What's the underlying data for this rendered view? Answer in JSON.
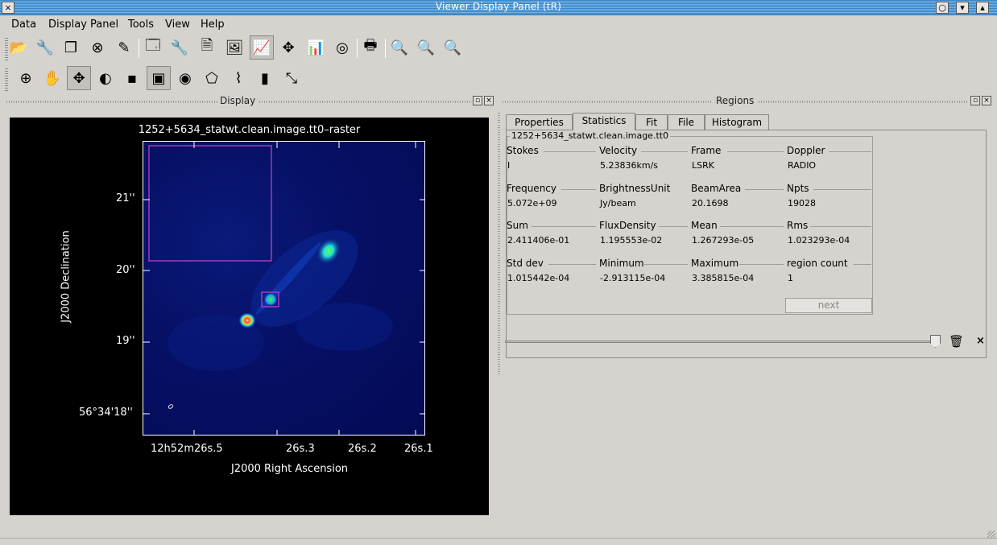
{
  "window": {
    "title": "Viewer Display Panel (tR)",
    "buttons": [
      "○",
      "▾",
      "▴"
    ],
    "close": "×"
  },
  "menu": [
    "Data",
    "Display Panel",
    "Tools",
    "View",
    "Help"
  ],
  "toolbar_main": [
    {
      "icon": "open-folder-icon",
      "glyph": "📂"
    },
    {
      "icon": "wrench-icon",
      "glyph": "🔧"
    },
    {
      "icon": "copy-icon",
      "glyph": "❐"
    },
    {
      "icon": "close-circle-icon",
      "glyph": "⊗"
    },
    {
      "icon": "edit-icon",
      "glyph": "✎"
    },
    {
      "icon": "new-panel-icon",
      "glyph": "🗔"
    },
    {
      "icon": "panel-options-icon",
      "glyph": "🔧"
    },
    {
      "icon": "save-panel-icon",
      "glyph": "🗎"
    },
    {
      "icon": "restore-panel-icon",
      "glyph": "🖼"
    },
    {
      "icon": "animator-icon",
      "glyph": "📈"
    },
    {
      "icon": "interactive-tools-icon",
      "glyph": "✥"
    },
    {
      "icon": "histogram-icon",
      "glyph": "📊"
    },
    {
      "icon": "colormap-icon",
      "glyph": "◎"
    },
    {
      "icon": "print-icon",
      "glyph": "🖶"
    },
    {
      "icon": "zoom-fit-icon",
      "glyph": "🔍"
    },
    {
      "icon": "zoom-in-icon",
      "glyph": "🔍"
    },
    {
      "icon": "zoom-out-icon",
      "glyph": "🔍"
    }
  ],
  "toolbar_mouse": [
    {
      "icon": "zoom-tool-icon",
      "glyph": "⊕"
    },
    {
      "icon": "pan-tool-icon",
      "glyph": "✋"
    },
    {
      "icon": "move-tool-icon",
      "glyph": "✥"
    },
    {
      "icon": "contrast-tool-icon",
      "glyph": "◐"
    },
    {
      "icon": "point-tool-icon",
      "glyph": "▪"
    },
    {
      "icon": "rectangle-region-icon",
      "glyph": "▣"
    },
    {
      "icon": "ellipse-region-icon",
      "glyph": "◉"
    },
    {
      "icon": "polygon-region-icon",
      "glyph": "⬠"
    },
    {
      "icon": "polyline-icon",
      "glyph": "⌇"
    },
    {
      "icon": "ruler-icon",
      "glyph": "▮"
    },
    {
      "icon": "position-velocity-icon",
      "glyph": "⤡"
    }
  ],
  "display_dock": {
    "title": "Display"
  },
  "regions_dock": {
    "title": "Regions"
  },
  "plot": {
    "title": "1252+5634_statwt.clean.image.tt0–raster",
    "xlabel": "J2000 Right Ascension",
    "ylabel": "J2000 Declination",
    "yticks": [
      "21''",
      "20''",
      "19''",
      "56°34'18''"
    ],
    "xticks": [
      "12h52m26s.5",
      "26s.3",
      "26s.2",
      "26s.1"
    ]
  },
  "tabs": [
    "Properties",
    "Statistics",
    "Fit",
    "File",
    "Histogram"
  ],
  "active_tab": "Statistics",
  "stats": {
    "image_name": "1252+5634_statwt.clean.image.tt0",
    "rows": [
      [
        {
          "label": "Stokes",
          "value": "I"
        },
        {
          "label": "Velocity",
          "value": "5.23836km/s"
        },
        {
          "label": "Frame",
          "value": "LSRK"
        },
        {
          "label": "Doppler",
          "value": "RADIO"
        }
      ],
      [
        {
          "label": "Frequency",
          "value": "5.072e+09"
        },
        {
          "label": "BrightnessUnit",
          "value": "Jy/beam"
        },
        {
          "label": "BeamArea",
          "value": "20.1698"
        },
        {
          "label": "Npts",
          "value": "19028"
        }
      ],
      [
        {
          "label": "Sum",
          "value": "2.411406e-01"
        },
        {
          "label": "FluxDensity",
          "value": "1.195553e-02"
        },
        {
          "label": "Mean",
          "value": "1.267293e-05"
        },
        {
          "label": "Rms",
          "value": "1.023293e-04"
        }
      ],
      [
        {
          "label": "Std dev",
          "value": "1.015442e-04"
        },
        {
          "label": "Minimum",
          "value": "-2.913115e-04"
        },
        {
          "label": "Maximum",
          "value": "3.385815e-04"
        },
        {
          "label": "region count",
          "value": "1"
        }
      ]
    ],
    "next_label": "next"
  }
}
